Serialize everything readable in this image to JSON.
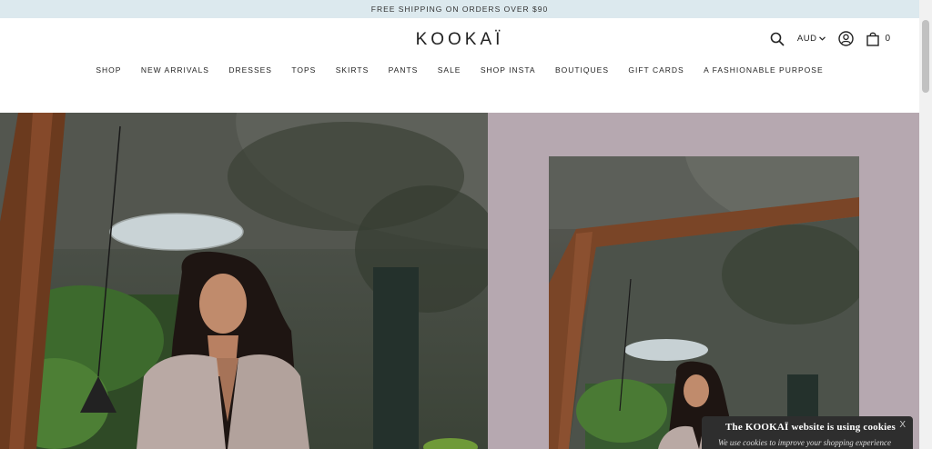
{
  "announcement": {
    "text": "FREE SHIPPING ON ORDERS OVER $90"
  },
  "header": {
    "logo": "KOOKAÏ",
    "currency": "AUD",
    "cart_count": "0"
  },
  "nav": {
    "items": [
      {
        "label": "SHOP"
      },
      {
        "label": "NEW ARRIVALS"
      },
      {
        "label": "DRESSES"
      },
      {
        "label": "TOPS"
      },
      {
        "label": "SKIRTS"
      },
      {
        "label": "PANTS"
      },
      {
        "label": "SALE"
      },
      {
        "label": "SHOP INSTA"
      },
      {
        "label": "BOUTIQUES"
      },
      {
        "label": "GIFT CARDS"
      },
      {
        "label": "A FASHIONABLE PURPOSE"
      }
    ]
  },
  "cookie_banner": {
    "title": "The KOOKAÏ website is using cookies",
    "body": "We use cookies to improve your shopping experience",
    "close_label": "X"
  },
  "colors": {
    "announcement_bg": "#dce9ee",
    "hero_right_bg": "#b6a8b0",
    "cookie_bg": "#2e2e2e"
  },
  "icons": [
    "search-icon",
    "chevron-down-icon",
    "account-icon",
    "cart-bag-icon",
    "close-icon"
  ]
}
